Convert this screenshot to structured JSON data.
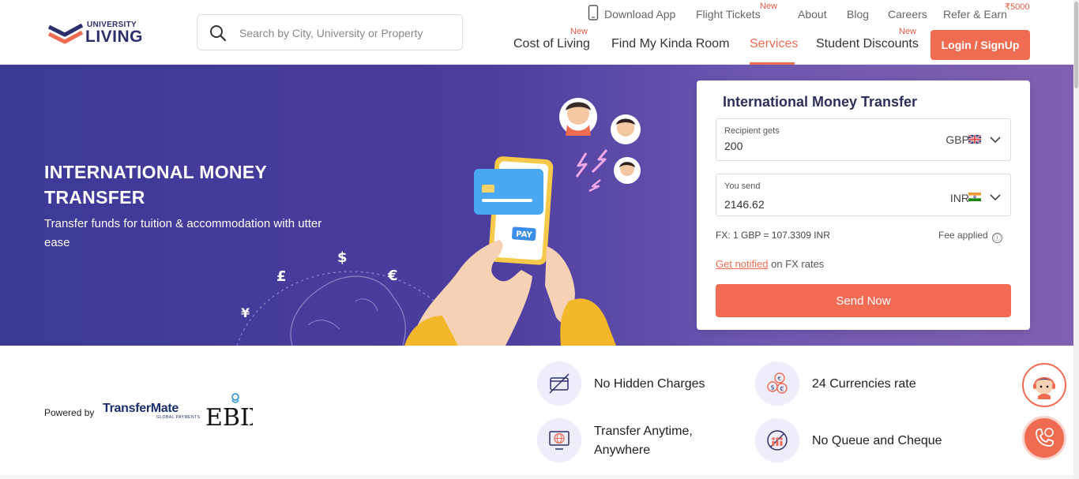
{
  "header": {
    "logo": {
      "small": "UNIVERSITY",
      "big": "LIVING"
    },
    "search": {
      "placeholder": "Search by City, University or Property",
      "value": ""
    },
    "top_nav": [
      {
        "label": "Download App"
      },
      {
        "label": "Flight Tickets",
        "badge": "New"
      },
      {
        "label": "About"
      },
      {
        "label": "Blog"
      },
      {
        "label": "Careers"
      },
      {
        "label": "Refer & Earn",
        "badge": "₹5000"
      }
    ],
    "main_nav": [
      {
        "label": "Cost of Living",
        "badge": "New"
      },
      {
        "label": "Find My Kinda Room"
      },
      {
        "label": "Services",
        "active": true
      },
      {
        "label": "Student Discounts",
        "badge": "New"
      }
    ],
    "login_label": "Login / SignUp"
  },
  "hero": {
    "title": "INTERNATIONAL MONEY TRANSFER",
    "subtitle": "Transfer funds for tuition & accommodation with utter ease",
    "pay_label": "PAY",
    "currency_symbols": [
      "$",
      "£",
      "€",
      "¥"
    ]
  },
  "transfer_card": {
    "title": "International Money Transfer",
    "recipient": {
      "label": "Recipient gets",
      "value": "200",
      "currency": "GBP"
    },
    "sender": {
      "label": "You send",
      "value": "2146.62",
      "currency": "INR"
    },
    "fx_rate": "FX: 1 GBP = 107.3309 INR",
    "fee_text": "Fee applied",
    "fee_icon": "ⓘ",
    "notify_link": "Get notified",
    "notify_text": " on FX rates",
    "send_label": "Send Now"
  },
  "powered_by": {
    "label": "Powered by",
    "partner1": "TransferMate",
    "partner1_sub": "GLOBAL PAYMENTS",
    "partner2": "EBIX"
  },
  "features": [
    {
      "label": "No Hidden Charges",
      "icon": "no-fees-card-icon"
    },
    {
      "label": "24 Currencies rate",
      "icon": "currency-coins-icon"
    },
    {
      "label": "Transfer Anytime, Anywhere",
      "icon": "globe-monitor-icon"
    },
    {
      "label": "No Queue and Cheque",
      "icon": "no-queue-icon"
    }
  ],
  "colors": {
    "accent": "#ef6c53",
    "hero_bg": "#3c3a96",
    "brand_navy": "#2b2f6b"
  }
}
